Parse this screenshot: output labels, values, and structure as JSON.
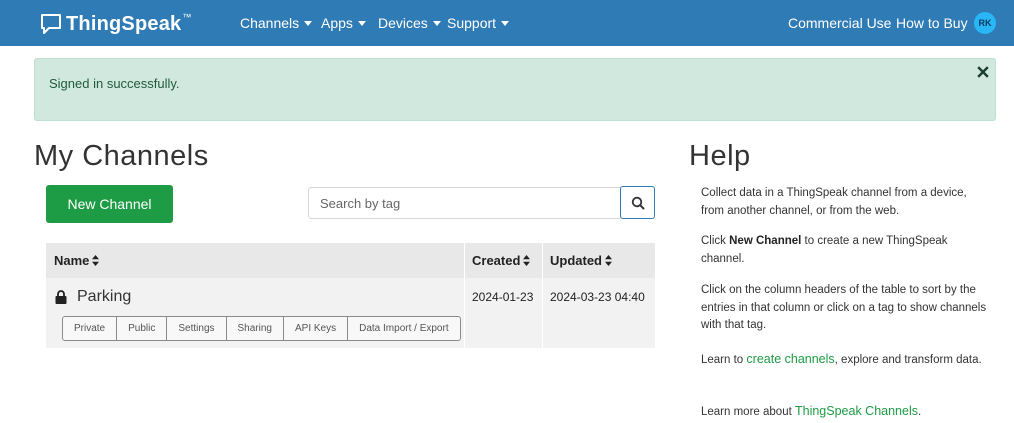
{
  "navbar": {
    "brand": "ThingSpeak",
    "brand_tm": "™",
    "menus": [
      "Channels",
      "Apps",
      "Devices",
      "Support"
    ],
    "links": [
      "Commercial Use",
      "How to Buy"
    ],
    "avatar_initials": "RK"
  },
  "alert": {
    "message": "Signed in successfully.",
    "close_icon": "close-icon"
  },
  "main": {
    "title": "My Channels",
    "new_channel_label": "New Channel",
    "search_placeholder": "Search by tag",
    "table": {
      "headers": [
        "Name",
        "Created",
        "Updated"
      ],
      "rows": [
        {
          "name": "Parking",
          "created": "2024-01-23",
          "updated": "2024-03-23 04:40",
          "actions": [
            "Private",
            "Public",
            "Settings",
            "Sharing",
            "API Keys",
            "Data Import / Export"
          ]
        }
      ]
    }
  },
  "help": {
    "title": "Help",
    "p1": "Collect data in a ThingSpeak channel from a device, from another channel, or from the web.",
    "p2_pre": "Click ",
    "p2_bold": "New Channel",
    "p2_post": " to create a new ThingSpeak channel.",
    "p3": "Click on the column headers of the table to sort by the entries in that column or click on a tag to show channels with that tag.",
    "p4_pre": "Learn to ",
    "p4_link": "create channels",
    "p4_post": ", explore and transform data.",
    "p5_pre": "Learn more about ",
    "p5_link": "ThingSpeak Channels",
    "p5_post": "."
  },
  "colors": {
    "navbar": "#2f7bb5",
    "alert_bg": "#d1e8df",
    "primary_green": "#1e9b45",
    "avatar": "#29b6f6"
  }
}
